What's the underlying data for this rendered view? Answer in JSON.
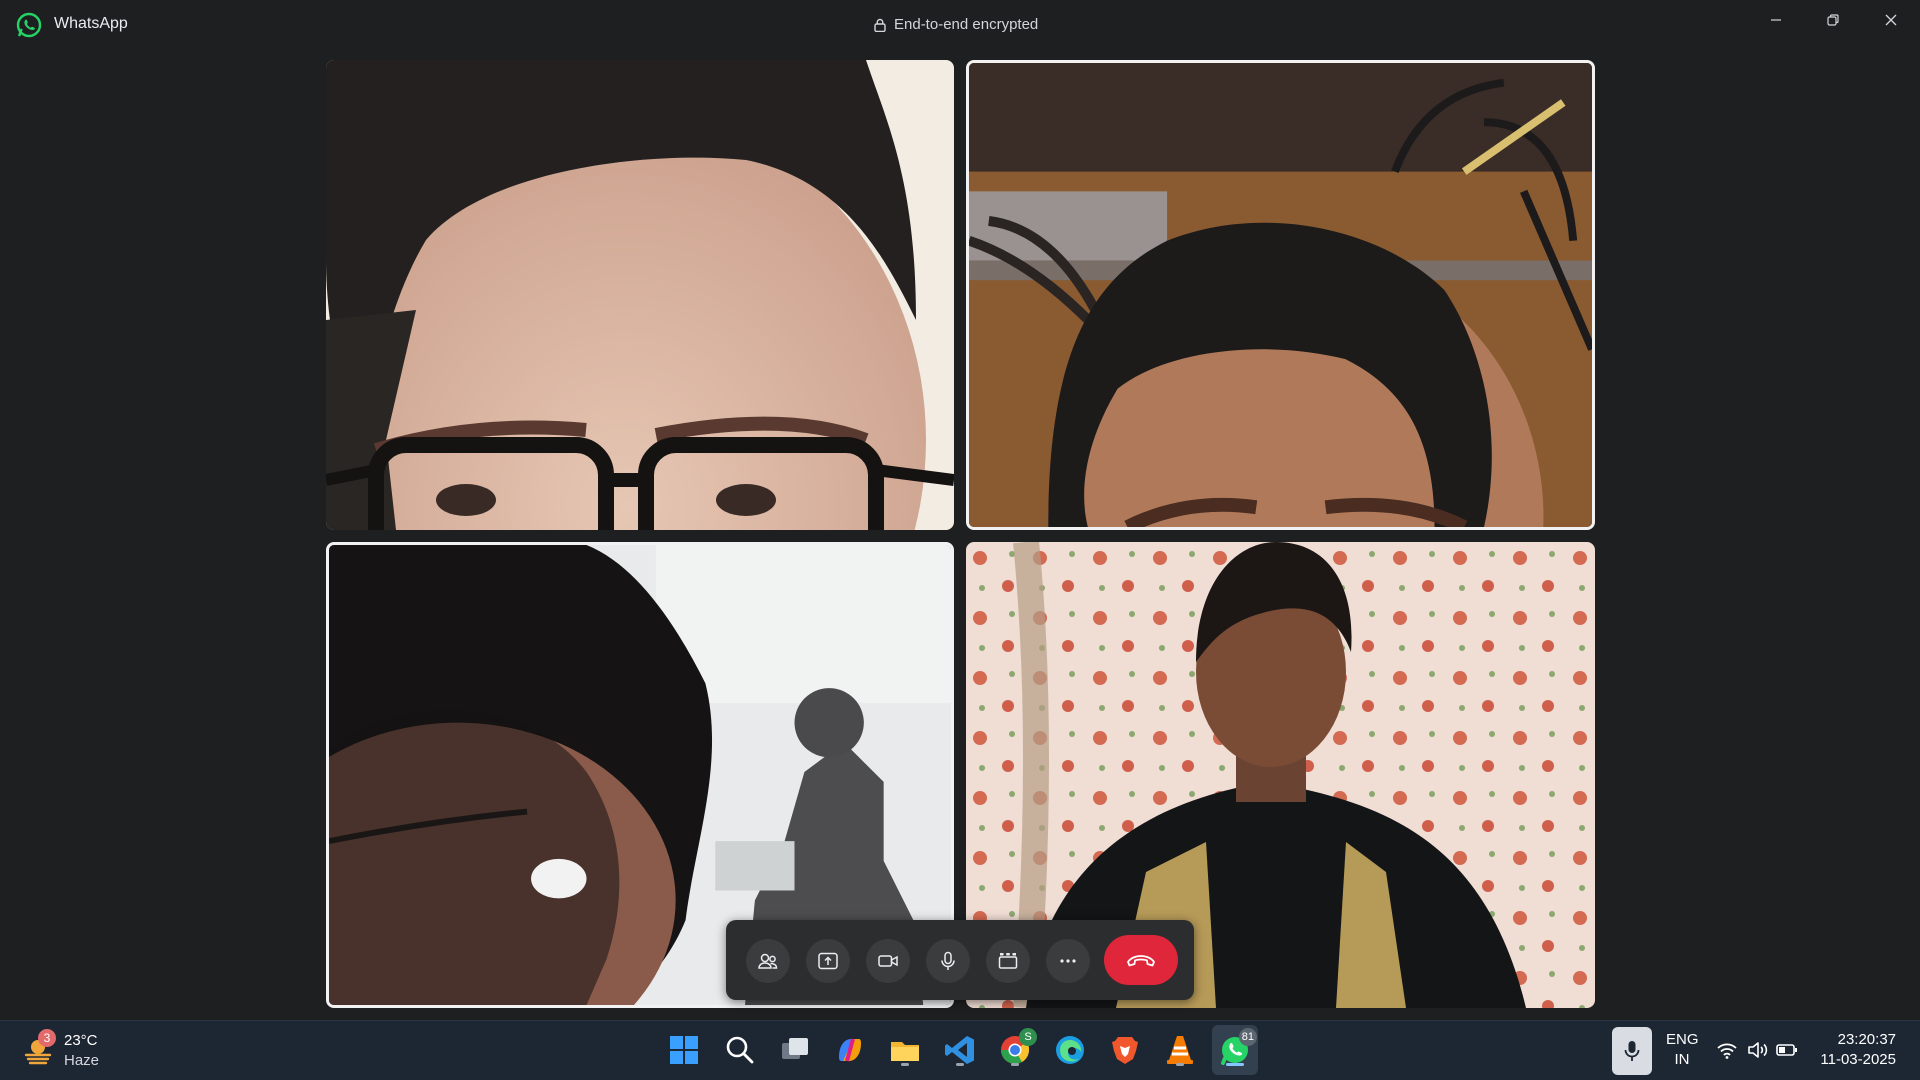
{
  "window": {
    "app_name": "WhatsApp",
    "encryption_label": "End-to-end encrypted"
  },
  "call": {
    "participants": [
      {
        "id": "participant-1",
        "video_on": true
      },
      {
        "id": "participant-2",
        "video_on": true,
        "speaking": true
      },
      {
        "id": "participant-3",
        "video_on": true,
        "speaking": true
      },
      {
        "id": "participant-4",
        "video_on": true
      }
    ],
    "controls": [
      {
        "name": "participants-button",
        "icon": "people-icon"
      },
      {
        "name": "share-screen-button",
        "icon": "share-screen-icon"
      },
      {
        "name": "camera-toggle-button",
        "icon": "video-camera-icon"
      },
      {
        "name": "mute-button",
        "icon": "microphone-icon"
      },
      {
        "name": "layout-button",
        "icon": "grid-layout-icon"
      },
      {
        "name": "more-options-button",
        "icon": "ellipsis-icon"
      },
      {
        "name": "end-call-button",
        "icon": "hang-up-icon",
        "color": "#e0263a"
      }
    ]
  },
  "taskbar": {
    "weather": {
      "badge": "3",
      "temp": "23°C",
      "condition": "Haze"
    },
    "apps": [
      {
        "name": "start",
        "icon": "windows-icon"
      },
      {
        "name": "search",
        "icon": "search-icon"
      },
      {
        "name": "task-view",
        "icon": "task-view-icon"
      },
      {
        "name": "copilot",
        "icon": "copilot-icon"
      },
      {
        "name": "file-explorer",
        "icon": "folder-icon",
        "running": true
      },
      {
        "name": "vscode",
        "icon": "vscode-icon",
        "running": true
      },
      {
        "name": "chrome",
        "icon": "chrome-icon",
        "running": true,
        "badge": "S"
      },
      {
        "name": "edge",
        "icon": "edge-icon"
      },
      {
        "name": "brave",
        "icon": "brave-icon"
      },
      {
        "name": "vlc",
        "icon": "vlc-icon",
        "running": true
      },
      {
        "name": "whatsapp",
        "icon": "whatsapp-icon",
        "running": true,
        "active": true,
        "badge": "81"
      }
    ],
    "language_line1": "ENG",
    "language_line2": "IN",
    "time": "23:20:37",
    "date": "11-03-2025"
  },
  "colors": {
    "background": "#1e1f20",
    "taskbar": "#1d2633",
    "whatsapp_green": "#25d366",
    "end_call_red": "#e0263a"
  }
}
